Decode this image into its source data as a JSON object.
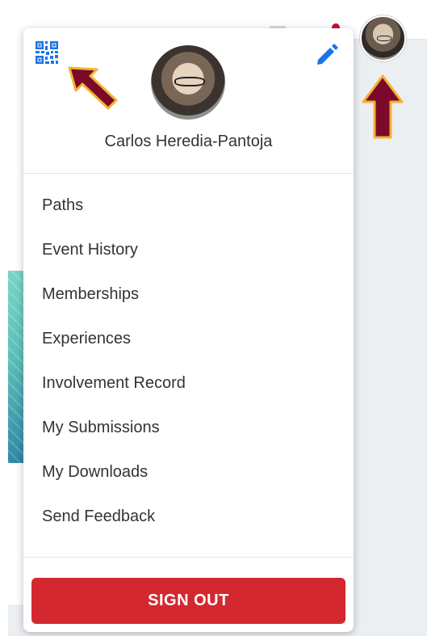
{
  "profile": {
    "name": "Carlos Heredia-Pantoja"
  },
  "menu": {
    "items": [
      {
        "label": "Paths"
      },
      {
        "label": "Event History"
      },
      {
        "label": "Memberships"
      },
      {
        "label": "Experiences"
      },
      {
        "label": "Involvement Record"
      },
      {
        "label": "My Submissions"
      },
      {
        "label": "My Downloads"
      },
      {
        "label": "Send Feedback"
      }
    ],
    "signout_label": "SIGN OUT"
  },
  "icons": {
    "qr": "qr-code-icon",
    "edit": "pencil-icon"
  },
  "colors": {
    "accent": "#1a73e8",
    "signout": "#d3282f",
    "annotation_arrow": "#7b0a2a",
    "annotation_outline": "#f2b233"
  }
}
